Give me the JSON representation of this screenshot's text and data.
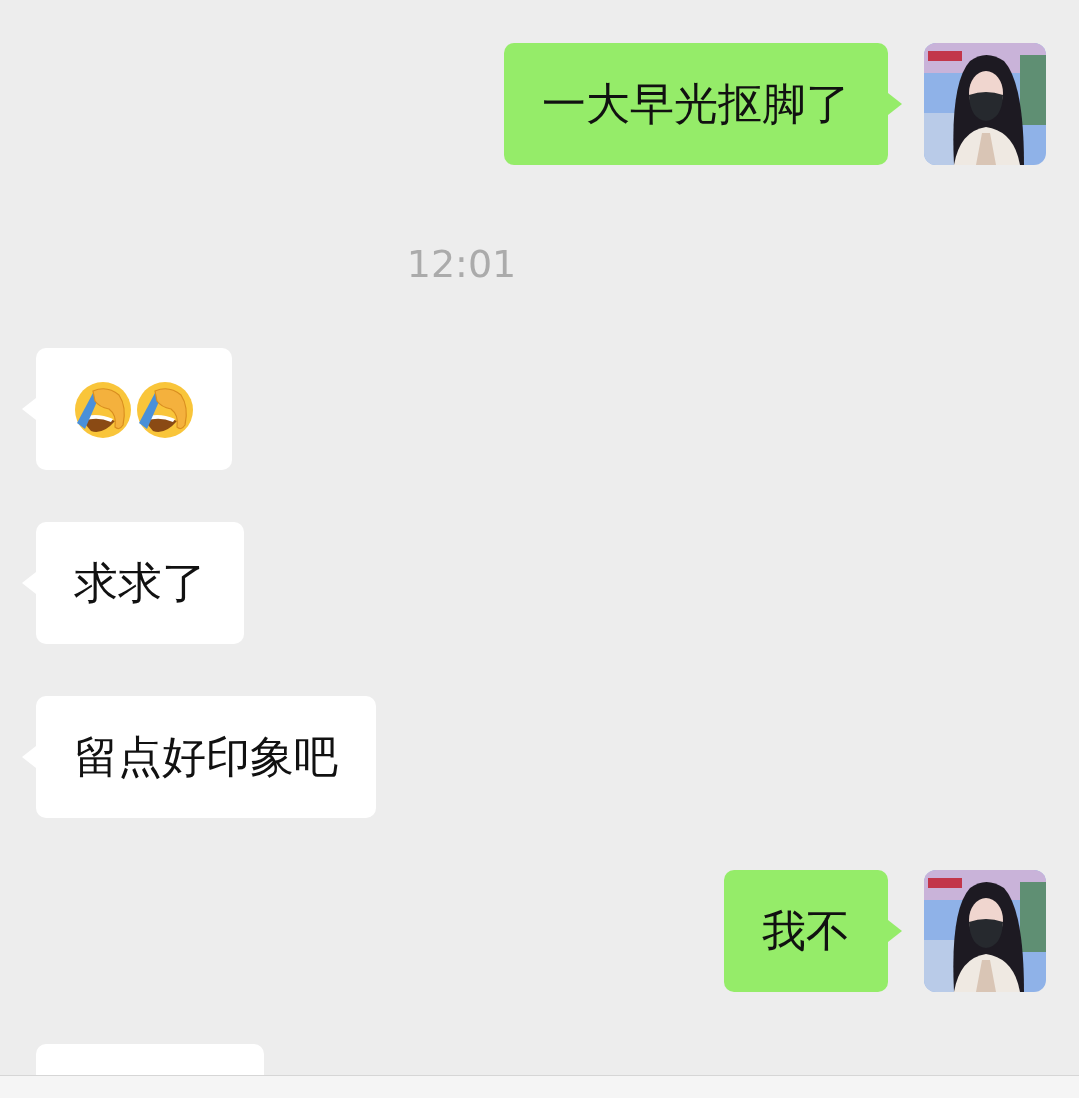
{
  "messages": [
    {
      "kind": "text",
      "outgoing": true,
      "text": "一大早光抠脚了"
    },
    {
      "kind": "time",
      "text": "12:01"
    },
    {
      "kind": "emoji",
      "outgoing": false,
      "emojis": [
        {
          "kind": "facepalm"
        },
        {
          "kind": "facepalm"
        }
      ]
    },
    {
      "kind": "text",
      "outgoing": false,
      "text": "求求了"
    },
    {
      "kind": "text",
      "outgoing": false,
      "text": "留点好印象吧"
    },
    {
      "kind": "text",
      "outgoing": true,
      "text": "我不"
    },
    {
      "kind": "cut",
      "outgoing": false
    }
  ]
}
